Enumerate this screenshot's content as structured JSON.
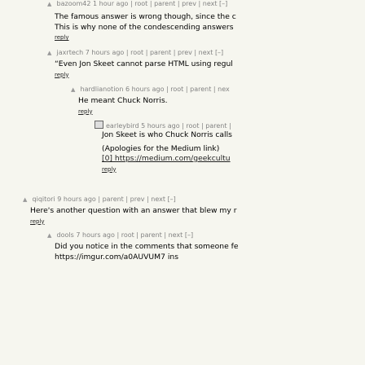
{
  "meta_labels": {
    "root": "root",
    "parent": "parent",
    "prev": "prev",
    "next": "next",
    "collapse": "[–]",
    "reply": "reply",
    "sep": "|",
    "vote": "▲"
  },
  "comments": [
    {
      "user": "bazoom42",
      "age": "1 hour ago",
      "lines": [
        "The famous answer is wrong though, since the c",
        "This is why none of the condescending answers"
      ]
    },
    {
      "user": "jaxrtech",
      "age": "7 hours ago",
      "lines": [
        "“Even Jon Skeet cannot parse HTML using regul"
      ]
    },
    {
      "user": "hardlianotion",
      "age": "6 hours ago",
      "lines": [
        "He meant Chuck Norris."
      ]
    },
    {
      "user": "earleybird",
      "age": "5 hours ago",
      "lines": [
        "Jon Skeet is who Chuck Norris calls",
        "(Apologies for the Medium link)",
        "[0] https://medium.com/geekcultu"
      ]
    },
    {
      "user": "qiqitori",
      "age": "9 hours ago",
      "lines": [
        "Here's another question with an answer that blew my r"
      ]
    },
    {
      "user": "dools",
      "age": "7 hours ago",
      "lines": [
        "Did you notice in the comments that someone fe",
        "https://imgur.com/a0AUVUM7 ins"
      ]
    }
  ]
}
